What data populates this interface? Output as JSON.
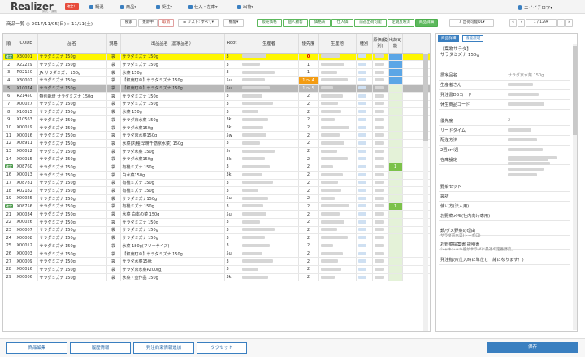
{
  "app": {
    "logo": "Realizer",
    "logo_sub": "卸売／通販",
    "badge": "確定！"
  },
  "nav": {
    "items": [
      "概況",
      "商品▾",
      "受注▾",
      "仕入・在庫▾",
      "出荷▾"
    ]
  },
  "user": {
    "name": "エイイチロウ▾"
  },
  "toolbar": {
    "page_title": "商品一覧 ◎ 2017/11/05(日) » 11/11(土)",
    "search": "検索",
    "updating": "更新中",
    "cancel": "取消",
    "list_all": "☰ リスト: すべて▾",
    "function": "機能▾",
    "tabs": [
      "販売価格",
      "個人顧客",
      "価格表",
      "仕入価",
      "前週出荷可能",
      "定期反映済",
      "商品詳細"
    ],
    "download": "⇩ 出荷可能DL▾",
    "pager": "1 / 129▾"
  },
  "table": {
    "headers": [
      "順",
      "CODE",
      "品名",
      "規格",
      "出品品名（農家品名）",
      "Root",
      "生産者",
      "優先度",
      "生産地",
      "種別",
      "原価(税別)",
      "出荷可能"
    ],
    "rows": [
      {
        "tag": "確定",
        "n": "1",
        "code": "X30001",
        "name": "サラダミズナ 150g",
        "spec": "袋",
        "alias": "サラダミズナ 150g",
        "root": "3",
        "pri": "0",
        "ship": "",
        "style": "yellow"
      },
      {
        "tag": "",
        "n": "2",
        "code": "X22229",
        "name": "サラダミズナ 150g",
        "spec": "袋",
        "alias": "サラダミズナ 150g",
        "root": "3",
        "pri": "1",
        "ship": "",
        "style": ""
      },
      {
        "tag": "",
        "n": "3",
        "code": "R02150",
        "name": "JA サラダミズナ 150g",
        "spec": "袋",
        "alias": "水菜 150g",
        "root": "3",
        "pri": "1",
        "ship": "",
        "style": ""
      },
      {
        "tag": "",
        "n": "4",
        "code": "X30002",
        "name": "サラダミズナ 150g",
        "spec": "袋",
        "alias": "【和東町の】サラダミズナ 150g",
        "root": "5u",
        "pri": "1 ～ 4",
        "ship": "",
        "style": ""
      },
      {
        "tag": "",
        "n": "5",
        "code": "X10074",
        "name": "サラダミズナ 150g",
        "spec": "袋",
        "alias": "【和東町の】サラダミズナ 150g",
        "root": "5u",
        "pri": "1 ～ 5",
        "ship": "",
        "style": "gray"
      },
      {
        "tag": "",
        "n": "6",
        "code": "R21450",
        "name": "特別栽培 サラダミズナ 150g",
        "spec": "袋",
        "alias": "サラダミズナ 150g",
        "root": "3",
        "pri": "2",
        "ship": "",
        "style": ""
      },
      {
        "tag": "",
        "n": "7",
        "code": "X00027",
        "name": "サラダミズナ 150g",
        "spec": "袋",
        "alias": "サラダミズナ 150g",
        "root": "3",
        "pri": "2",
        "ship": "",
        "style": ""
      },
      {
        "tag": "",
        "n": "8",
        "code": "X10015",
        "name": "サラダミズナ 150g",
        "spec": "袋",
        "alias": "水菜 150g",
        "root": "3",
        "pri": "2",
        "ship": "",
        "style": ""
      },
      {
        "tag": "",
        "n": "9",
        "code": "X10563",
        "name": "サラダミズナ 150g",
        "spec": "袋",
        "alias": "サラダ京水菜 150g",
        "root": "3k",
        "pri": "2",
        "ship": "",
        "style": ""
      },
      {
        "tag": "",
        "n": "10",
        "code": "X00019",
        "name": "サラダミズナ 150g",
        "spec": "袋",
        "alias": "サラダ水菜150g",
        "root": "3k",
        "pri": "2",
        "ship": "",
        "style": ""
      },
      {
        "tag": "",
        "n": "11",
        "code": "X00016",
        "name": "サラダミズナ 150g",
        "spec": "袋",
        "alias": "サラダ京水菜150g",
        "root": "5w",
        "pri": "2",
        "ship": "",
        "style": ""
      },
      {
        "tag": "",
        "n": "12",
        "code": "X08911",
        "name": "サラダミズナ 150g",
        "spec": "袋",
        "alias": "水菜(丸種 早晩千筋京水菜) 150g",
        "root": "3",
        "pri": "2",
        "ship": "",
        "style": ""
      },
      {
        "tag": "",
        "n": "13",
        "code": "X00012",
        "name": "サラダミズナ 150g",
        "spec": "袋",
        "alias": "サラダ水菜 150g",
        "root": "5r",
        "pri": "2",
        "ship": "",
        "style": ""
      },
      {
        "tag": "",
        "n": "14",
        "code": "X00015",
        "name": "サラダミズナ 150g",
        "spec": "袋",
        "alias": "サラダ水菜150g",
        "root": "3k",
        "pri": "2",
        "ship": "",
        "style": ""
      },
      {
        "tag": "確定",
        "n": "15",
        "code": "X08760",
        "name": "サラダミズナ 150g",
        "spec": "袋",
        "alias": "有機ミズナ 150g",
        "root": "3",
        "pri": "2",
        "ship": "1",
        "style": ""
      },
      {
        "tag": "",
        "n": "16",
        "code": "X00013",
        "name": "サラダミズナ 150g",
        "spec": "袋",
        "alias": "白水菜150g",
        "root": "3k",
        "pri": "2",
        "ship": "",
        "style": ""
      },
      {
        "tag": "",
        "n": "17",
        "code": "X08781",
        "name": "サラダミズナ 150g",
        "spec": "袋",
        "alias": "有機ミズナ 150g",
        "root": "3",
        "pri": "2",
        "ship": "",
        "style": ""
      },
      {
        "tag": "",
        "n": "18",
        "code": "R02182",
        "name": "サラダミズナ 150g",
        "spec": "袋",
        "alias": "有機ミズナ 150g",
        "root": "3",
        "pri": "2",
        "ship": "",
        "style": ""
      },
      {
        "tag": "",
        "n": "19",
        "code": "X00025",
        "name": "サラダミズナ 150g",
        "spec": "袋",
        "alias": "サラダミズナ150g",
        "root": "5u",
        "pri": "2",
        "ship": "",
        "style": ""
      },
      {
        "tag": "確定",
        "n": "20",
        "code": "X08756",
        "name": "サラダミズナ 150g",
        "spec": "袋",
        "alias": "有機ミズナ 150g",
        "root": "3",
        "pri": "2",
        "ship": "1",
        "style": ""
      },
      {
        "tag": "",
        "n": "21",
        "code": "X00034",
        "name": "サラダミズナ 150g",
        "spec": "袋",
        "alias": "水菜 白本の菜 150g",
        "root": "5u",
        "pri": "2",
        "ship": "",
        "style": ""
      },
      {
        "tag": "",
        "n": "22",
        "code": "X00026",
        "name": "サラダミズナ 150g",
        "spec": "袋",
        "alias": "サラダミズナ 150g",
        "root": "3",
        "pri": "2",
        "ship": "",
        "style": ""
      },
      {
        "tag": "",
        "n": "23",
        "code": "X00007",
        "name": "サラダミズナ 150g",
        "spec": "袋",
        "alias": "サラダミズナ 150g",
        "root": "3",
        "pri": "2",
        "ship": "",
        "style": ""
      },
      {
        "tag": "",
        "n": "24",
        "code": "X00008",
        "name": "サラダミズナ 150g",
        "spec": "袋",
        "alias": "サラダミズナ 150g",
        "root": "3",
        "pri": "2",
        "ship": "",
        "style": ""
      },
      {
        "tag": "",
        "n": "25",
        "code": "X00012",
        "name": "サラダミズナ 150g",
        "spec": "袋",
        "alias": "水菜 180g(フリーサイズ)",
        "root": "3",
        "pri": "2",
        "ship": "",
        "style": ""
      },
      {
        "tag": "",
        "n": "26",
        "code": "X00003",
        "name": "サラダミズナ 150g",
        "spec": "袋",
        "alias": "【和東町の】サラダミズナ 150g",
        "root": "5u",
        "pri": "2",
        "ship": "",
        "style": ""
      },
      {
        "tag": "",
        "n": "27",
        "code": "X00009",
        "name": "サラダミズナ 150g",
        "spec": "袋",
        "alias": "サラダ水菜150t",
        "root": "3",
        "pri": "2",
        "ship": "",
        "style": ""
      },
      {
        "tag": "",
        "n": "28",
        "code": "X00016",
        "name": "サラダミズナ 150g",
        "spec": "袋",
        "alias": "サラダ京水菜P200(g)",
        "root": "3",
        "pri": "2",
        "ship": "",
        "style": ""
      },
      {
        "tag": "",
        "n": "29",
        "code": "X00006",
        "name": "サラダミズナ 150g",
        "spec": "袋",
        "alias": "水菜・壺作品 150g",
        "root": "3k",
        "pri": "2",
        "ship": "",
        "style": ""
      }
    ]
  },
  "detail": {
    "tabs": [
      "商品詳細",
      "機能説明"
    ],
    "head1": "【葉物サラダ】",
    "head2": "サラダミズナ 150g",
    "rows": [
      {
        "label": "農家品名",
        "value": "サラダ京水菜 150g"
      },
      {
        "label": "生産者さん",
        "value": ""
      },
      {
        "label": "発注書DBコード",
        "value": ""
      },
      {
        "label": "休生商品コード",
        "value": ""
      },
      {
        "label": "優先度",
        "value": "2"
      },
      {
        "label": "リードタイム",
        "value": ""
      },
      {
        "label": "配送方法",
        "value": ""
      },
      {
        "label": "2週or4週",
        "value": ""
      },
      {
        "label": "在庫設定",
        "value": ""
      },
      {
        "label": "野菜セット",
        "value": ""
      },
      {
        "label": "袋詰",
        "value": ""
      },
      {
        "label": "使い方(法人用)",
        "value": ""
      },
      {
        "label": "お野菜メモ(社内向け専用)",
        "value": ""
      },
      {
        "label": "鍋/ダメ野菜の理由",
        "value": ""
      },
      {
        "label": "お野菜提案書 説明書",
        "value": ""
      },
      {
        "label": "発注指示(仕入時に単位と一緒になります！)",
        "value": ""
      }
    ],
    "sub_reason": "サラダ京水菜(トーポロ)",
    "sub_desc": "シャキシャキ感がサラダに最適の定番野菜。"
  },
  "footer": {
    "buttons": [
      "商品編集",
      "履歴情報",
      "発注約束情報追加",
      "タグセット",
      "保存"
    ]
  }
}
